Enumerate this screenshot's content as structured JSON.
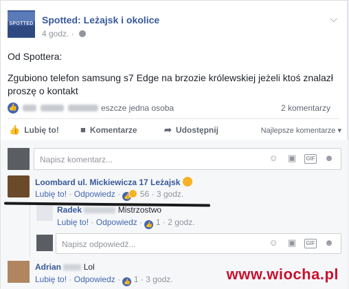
{
  "post": {
    "page_name": "Spotted: Leżajsk i okolice",
    "time": "4 godz.",
    "avatar_text": "SPOTTED",
    "menu_icon": "chevron-down-icon",
    "body_line1": "Od Spottera:",
    "body_line2": "Zgubiono telefon samsung s7 Edge na brzozie królewskiej jeżeli ktoś znalazł proszę o kontakt",
    "reactors_suffix": "eszcze jedna osoba",
    "comments_count": "2 komentarzy"
  },
  "actions": {
    "like": "Lubię to!",
    "comment": "Komentarze",
    "share": "Udostępnij",
    "sort": "Najlepsze komentarze"
  },
  "comment_input": {
    "placeholder": "Napisz komentarz..."
  },
  "comments": [
    {
      "name": "Loombard ul. Mickiewicza 17 Leżajsk",
      "text": "",
      "like": "Lubię to!",
      "reply": "Odpowiedz",
      "reactions": "56",
      "time": "3 godz."
    },
    {
      "name": "Radek",
      "text": "Mistrzostwo",
      "like": "Lubię to!",
      "reply": "Odpowiedz",
      "reactions": "1",
      "time": "2 godz."
    },
    {
      "name": "Adrian",
      "text": "Lol",
      "like": "Lubię to!",
      "reply": "Odpowiedz",
      "reactions": "1",
      "time": "3 godz."
    }
  ],
  "reply_input": {
    "placeholder": "Napisz odpowiedź..."
  },
  "separator": "·",
  "watermark": "www.wiocha.pl",
  "colors": {
    "link": "#365899",
    "accent": "#4267b2",
    "muted": "#90949c",
    "watermark": "#c8102e"
  }
}
